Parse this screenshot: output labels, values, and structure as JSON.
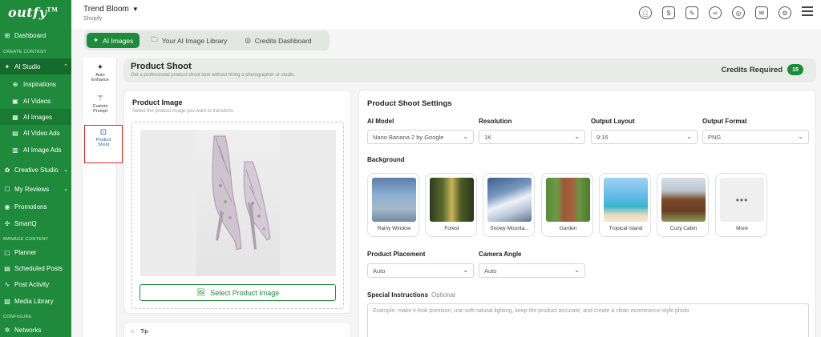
{
  "sidebar": {
    "logo": "outfy",
    "logo_mark": "TM",
    "dashboard": "Dashboard",
    "section_create": "CREATE CONTENT",
    "ai_studio": "AI Studio",
    "inspirations": "Inspirations",
    "ai_videos": "AI Videos",
    "ai_images": "AI Images",
    "ai_video_ads": "AI Video Ads",
    "ai_image_ads": "AI Image Ads",
    "creative_studio": "Creative Studio",
    "my_reviews": "My Reviews",
    "promotions": "Promotions",
    "smartq": "SmartQ",
    "section_manage": "MANAGE CONTENT",
    "planner": "Planner",
    "scheduled_posts": "Scheduled Posts",
    "post_activity": "Post Activity",
    "media_library": "Media Library",
    "section_configure": "CONFIGURE",
    "networks": "Networks"
  },
  "topbar": {
    "store_name": "Trend Bloom",
    "platform": "Shopify"
  },
  "tabs": {
    "ai_images": "AI Images",
    "library": "Your AI Image Library",
    "credits": "Credits Dashboard"
  },
  "tools": {
    "auto_enhance_1": "Auto",
    "auto_enhance_2": "Enhance",
    "custom_prompt_1": "Custom",
    "custom_prompt_2": "Prompt",
    "product_shoot_1": "Product",
    "product_shoot_2": "Shoot"
  },
  "header": {
    "title": "Product Shoot",
    "subtitle": "Get a professional product shoot look without hiring a photographer or studio.",
    "credits_label": "Credits Required",
    "credits_value": "15"
  },
  "product_image": {
    "title": "Product Image",
    "subtitle": "Select the product image you want to transform.",
    "select_button": "Select Product Image"
  },
  "tip": {
    "label": "Tip"
  },
  "settings": {
    "title": "Product Shoot Settings",
    "ai_model_label": "AI Model",
    "ai_model_value": "Nano Banana 2 by Google",
    "resolution_label": "Resolution",
    "resolution_value": "1K",
    "layout_label": "Output Layout",
    "layout_value": "9:16",
    "format_label": "Output Format",
    "format_value": "PNG",
    "background_label": "Background",
    "backgrounds": [
      "Rainy Window",
      "Forest",
      "Snowy Mounta...",
      "Garden",
      "Tropical Island",
      "Cozy Cabin",
      "More"
    ],
    "placement_label": "Product Placement",
    "placement_value": "Auto",
    "angle_label": "Camera Angle",
    "angle_value": "Auto",
    "special_label": "Special Instructions",
    "special_optional": "Optional",
    "special_placeholder": "Example: make it look premium, use soft natural lighting, keep the product accurate, and create a clean ecommerce-style photo"
  },
  "colors": {
    "brand_green": "#1f8a3c",
    "highlight_red": "#d62828"
  }
}
